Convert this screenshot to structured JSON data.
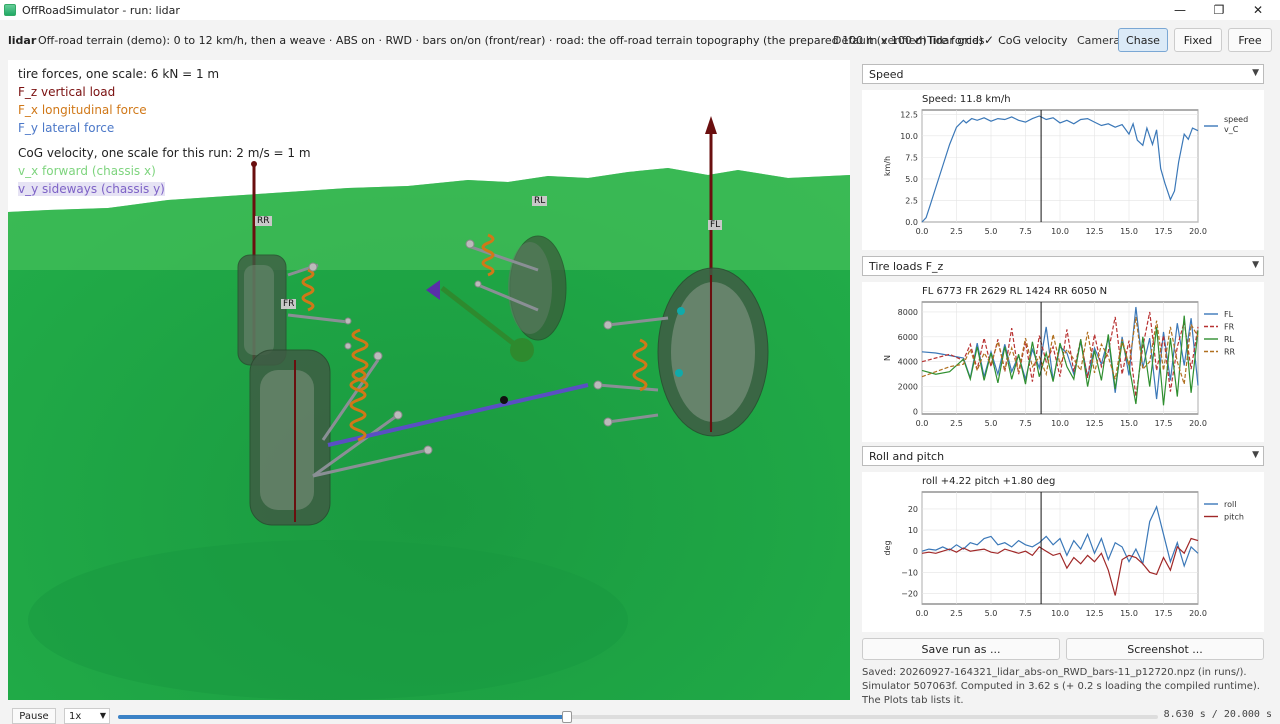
{
  "window": {
    "title": "OffRoadSimulator - run: lidar",
    "minimize": "—",
    "maximize": "❐",
    "close": "✕"
  },
  "toolbar": {
    "run_label": "lidar",
    "run_desc": "Off-road terrain (demo): 0 to 12 km/h, then a weave  ·  ABS on  ·  RWD  ·  bars on/on (front/rear)  ·  road: the off-road terrain topography (the prepared 100 m x 100 m lidar grid)",
    "default_verified": "Default (verified)",
    "tire_forces": "Tire forces",
    "cog_velocity": "CoG velocity",
    "checkmark": "✓",
    "camera_label": "Camera:",
    "cam_chase": "Chase",
    "cam_fixed": "Fixed",
    "cam_free": "Free"
  },
  "viewport": {
    "legend": {
      "scale": "tire forces, one scale: 6 kN = 1 m",
      "fz": "F_z  vertical load",
      "fx": "F_x  longitudinal force",
      "fy": "F_y  lateral force",
      "cog_scale": "CoG velocity, one scale for this run: 2 m/s = 1 m",
      "vx": "v_x  forward (chassis x)",
      "vy": "v_y  sideways (chassis y)"
    },
    "wheel_labels": {
      "rr": "RR",
      "rl": "RL",
      "fl": "FL",
      "fr": "FR"
    },
    "colors": {
      "fz": "#7a1010",
      "fx": "#d07818",
      "fy": "#4c78c8",
      "vx": "#7ed47e",
      "vy": "#7d62c6",
      "terrain": "#1ea445"
    }
  },
  "panels": [
    {
      "dropdown": "Speed",
      "title": "Speed: 11.8 km/h",
      "ylabel": "km/h",
      "legend": [
        "speed",
        "v_C"
      ],
      "yticks": [
        "12.5",
        "10.0",
        "7.5",
        "5.0",
        "2.5",
        "0.0"
      ],
      "xticks": [
        "0.0",
        "2.5",
        "5.0",
        "7.5",
        "10.0",
        "12.5",
        "15.0",
        "17.5",
        "20.0"
      ]
    },
    {
      "dropdown": "Tire loads F_z",
      "title": "FL 6773   FR 2629   RL 1424   RR 6050  N",
      "ylabel": "N",
      "legend": [
        "FL",
        "FR",
        "RL",
        "RR"
      ],
      "yticks": [
        "8000",
        "6000",
        "4000",
        "2000",
        "0"
      ],
      "xticks": [
        "0.0",
        "2.5",
        "5.0",
        "7.5",
        "10.0",
        "12.5",
        "15.0",
        "17.5",
        "20.0"
      ]
    },
    {
      "dropdown": "Roll and pitch",
      "title": "roll +4.22   pitch +1.80  deg",
      "ylabel": "deg",
      "legend": [
        "roll",
        "pitch"
      ],
      "yticks": [
        "20",
        "10",
        "0",
        "−10",
        "−20"
      ],
      "xticks": [
        "0.0",
        "2.5",
        "5.0",
        "7.5",
        "10.0",
        "12.5",
        "15.0",
        "17.5",
        "20.0"
      ]
    }
  ],
  "chart_data": [
    {
      "type": "line",
      "title": "Speed: 11.8 km/h",
      "xlabel": "",
      "ylabel": "km/h",
      "xlim": [
        0,
        20
      ],
      "ylim": [
        0,
        13
      ],
      "cursor_x": 8.63,
      "series": [
        {
          "name": "speed v_C",
          "color": "#3b78b8",
          "x": [
            0,
            0.3,
            0.6,
            1,
            1.5,
            2,
            2.5,
            3,
            3.2,
            3.6,
            4,
            4.5,
            5,
            5.5,
            6,
            6.5,
            7,
            7.5,
            8,
            8.5,
            9,
            9.5,
            10,
            10.5,
            11,
            11.5,
            12,
            12.5,
            13,
            13.5,
            14,
            14.5,
            15,
            15.3,
            15.6,
            16,
            16.3,
            16.7,
            17,
            17.3,
            17.6,
            18,
            18.3,
            18.6,
            19,
            19.3,
            19.6,
            20
          ],
          "y": [
            0,
            0.5,
            2,
            4,
            6.5,
            9,
            11,
            11.8,
            11.5,
            12,
            11.8,
            12.1,
            11.7,
            12.0,
            11.9,
            12.2,
            11.8,
            11.6,
            12.0,
            12.3,
            11.9,
            12.1,
            11.5,
            11.8,
            11.4,
            11.9,
            12.0,
            11.6,
            11.2,
            11.4,
            11.0,
            11.3,
            10.2,
            11.4,
            9.5,
            8.9,
            10.9,
            9.0,
            10.7,
            6.2,
            4.5,
            2.6,
            3.6,
            7.0,
            10.2,
            9.6,
            10.9,
            10.6
          ]
        }
      ]
    },
    {
      "type": "line",
      "title": "FL 6773   FR 2629   RL 1424   RR 6050  N",
      "xlabel": "",
      "ylabel": "N",
      "xlim": [
        0,
        20
      ],
      "ylim": [
        -200,
        8800
      ],
      "cursor_x": 8.63,
      "series": [
        {
          "name": "FL",
          "color": "#3b78b8",
          "dash": "",
          "x": [
            0,
            1,
            2,
            3,
            3.5,
            4,
            4.5,
            5,
            5.5,
            6,
            6.5,
            7,
            7.5,
            8,
            8.5,
            9,
            9.5,
            10,
            10.5,
            11,
            11.5,
            12,
            12.5,
            13,
            13.5,
            14,
            14.5,
            15,
            15.5,
            16,
            16.5,
            17,
            17.5,
            18,
            18.5,
            19,
            19.5,
            20
          ],
          "y": [
            4800,
            4700,
            4500,
            4300,
            2700,
            5500,
            2800,
            4800,
            3000,
            5400,
            3200,
            4500,
            2600,
            5000,
            3500,
            6800,
            2500,
            5200,
            4700,
            3000,
            5600,
            2800,
            5100,
            3800,
            5900,
            1500,
            6000,
            2900,
            8400,
            3500,
            5900,
            1000,
            6400,
            2500,
            7100,
            3700,
            7500,
            2100
          ]
        },
        {
          "name": "FR",
          "color": "#b83232",
          "dash": "4,2",
          "x": [
            0,
            1,
            2,
            3,
            3.5,
            4,
            4.5,
            5,
            5.5,
            6,
            6.5,
            7,
            7.5,
            8,
            8.5,
            9,
            9.5,
            10,
            10.5,
            11,
            11.5,
            12,
            12.5,
            13,
            13.5,
            14,
            14.5,
            15,
            15.5,
            16,
            16.5,
            17,
            17.5,
            18,
            18.5,
            19,
            19.5,
            20
          ],
          "y": [
            4000,
            4300,
            4600,
            4100,
            5400,
            3400,
            5900,
            3600,
            5800,
            3200,
            6700,
            3000,
            5600,
            2400,
            6100,
            4000,
            5200,
            2800,
            6600,
            3200,
            5800,
            2700,
            6200,
            3600,
            4800,
            7600,
            3000,
            5700,
            1200,
            5200,
            8000,
            3300,
            6100,
            1600,
            5200,
            7200,
            3400,
            6800
          ]
        },
        {
          "name": "RL",
          "color": "#2f8f2f",
          "dash": "",
          "x": [
            0,
            1,
            2,
            3,
            3.5,
            4,
            4.5,
            5,
            5.5,
            6,
            6.5,
            7,
            7.5,
            8,
            8.5,
            9,
            9.5,
            10,
            10.5,
            11,
            11.5,
            12,
            12.5,
            13,
            13.5,
            14,
            14.5,
            15,
            15.5,
            16,
            16.5,
            17,
            17.5,
            18,
            18.5,
            19,
            19.5,
            20
          ],
          "y": [
            3300,
            3000,
            3200,
            4200,
            2600,
            5200,
            2500,
            4700,
            2300,
            5200,
            2600,
            4600,
            2200,
            5600,
            2800,
            4700,
            2400,
            5500,
            3600,
            2600,
            5800,
            2000,
            4900,
            2500,
            6200,
            1800,
            5600,
            3700,
            600,
            6000,
            2000,
            6800,
            500,
            5900,
            1200,
            7700,
            1500,
            6500
          ]
        },
        {
          "name": "RR",
          "color": "#b07020",
          "dash": "4,2",
          "x": [
            0,
            1,
            2,
            3,
            3.5,
            4,
            4.5,
            5,
            5.5,
            6,
            6.5,
            7,
            7.5,
            8,
            8.5,
            9,
            9.5,
            10,
            10.5,
            11,
            11.5,
            12,
            12.5,
            13,
            13.5,
            14,
            14.5,
            15,
            15.5,
            16,
            16.5,
            17,
            17.5,
            18,
            18.5,
            19,
            19.5,
            20
          ],
          "y": [
            2800,
            3200,
            3600,
            3800,
            5000,
            3300,
            4700,
            3800,
            5600,
            3400,
            5100,
            3200,
            5900,
            3600,
            4400,
            3000,
            6200,
            3800,
            5000,
            4200,
            3300,
            6400,
            3100,
            5400,
            4400,
            2600,
            5800,
            3700,
            7600,
            3400,
            4000,
            7300,
            3300,
            6800,
            4000,
            2200,
            7000,
            6000
          ]
        }
      ]
    },
    {
      "type": "line",
      "title": "roll +4.22   pitch +1.80  deg",
      "xlabel": "",
      "ylabel": "deg",
      "xlim": [
        0,
        20
      ],
      "ylim": [
        -25,
        28
      ],
      "cursor_x": 8.63,
      "series": [
        {
          "name": "roll",
          "color": "#3b78b8",
          "x": [
            0,
            0.5,
            1,
            1.5,
            2,
            2.5,
            3,
            3.5,
            4,
            4.5,
            5,
            5.5,
            6,
            6.5,
            7,
            7.5,
            8,
            8.5,
            9,
            9.5,
            10,
            10.5,
            11,
            11.5,
            12,
            12.5,
            13,
            13.5,
            14,
            14.5,
            15,
            15.5,
            16,
            16.5,
            17,
            17.5,
            18,
            18.5,
            19,
            19.5,
            20
          ],
          "y": [
            0,
            1,
            0.5,
            2,
            0.5,
            3,
            1,
            4,
            3,
            6,
            7,
            3,
            4,
            2,
            5,
            3,
            2,
            4,
            7,
            3,
            6,
            -2,
            5,
            1,
            8,
            -1,
            6,
            -4,
            4,
            2,
            -5,
            1,
            -6,
            14,
            21,
            8,
            -5,
            4,
            -7,
            2,
            -1
          ]
        },
        {
          "name": "pitch",
          "color": "#a02828",
          "x": [
            0,
            0.5,
            1,
            1.5,
            2,
            2.5,
            3,
            3.5,
            4,
            4.5,
            5,
            5.5,
            6,
            6.5,
            7,
            7.5,
            8,
            8.5,
            9,
            9.5,
            10,
            10.5,
            11,
            11.5,
            12,
            12.5,
            13,
            13.5,
            14,
            14.5,
            15,
            15.5,
            16,
            16.5,
            17,
            17.5,
            18,
            18.5,
            19,
            19.5,
            20
          ],
          "y": [
            -1,
            -0.5,
            -1,
            0,
            1,
            -0.5,
            1.5,
            0,
            0.5,
            1,
            -0.5,
            -1,
            1,
            0,
            -1,
            0,
            -2,
            2,
            0,
            -2,
            -1,
            -8,
            -3,
            -6,
            -2,
            -5,
            -1,
            -9,
            -21,
            -4,
            -2,
            -3,
            -6,
            -10,
            -11,
            -3,
            -9,
            2,
            -1,
            6,
            5
          ]
        }
      ]
    }
  ],
  "buttons": {
    "save_run": "Save run as ...",
    "screenshot": "Screenshot ..."
  },
  "saved_text": "Saved: 20260927-164321_lidar_abs-on_RWD_bars-11_p12720.npz (in runs/).  Simulator 507063f.  Computed in 3.62 s (+ 0.2 s loading the compiled runtime).  The Plots tab lists it.",
  "playback": {
    "pause": "Pause",
    "speed": "1x",
    "progress": 0.4315,
    "time": "8.630 s / 20.000 s"
  }
}
